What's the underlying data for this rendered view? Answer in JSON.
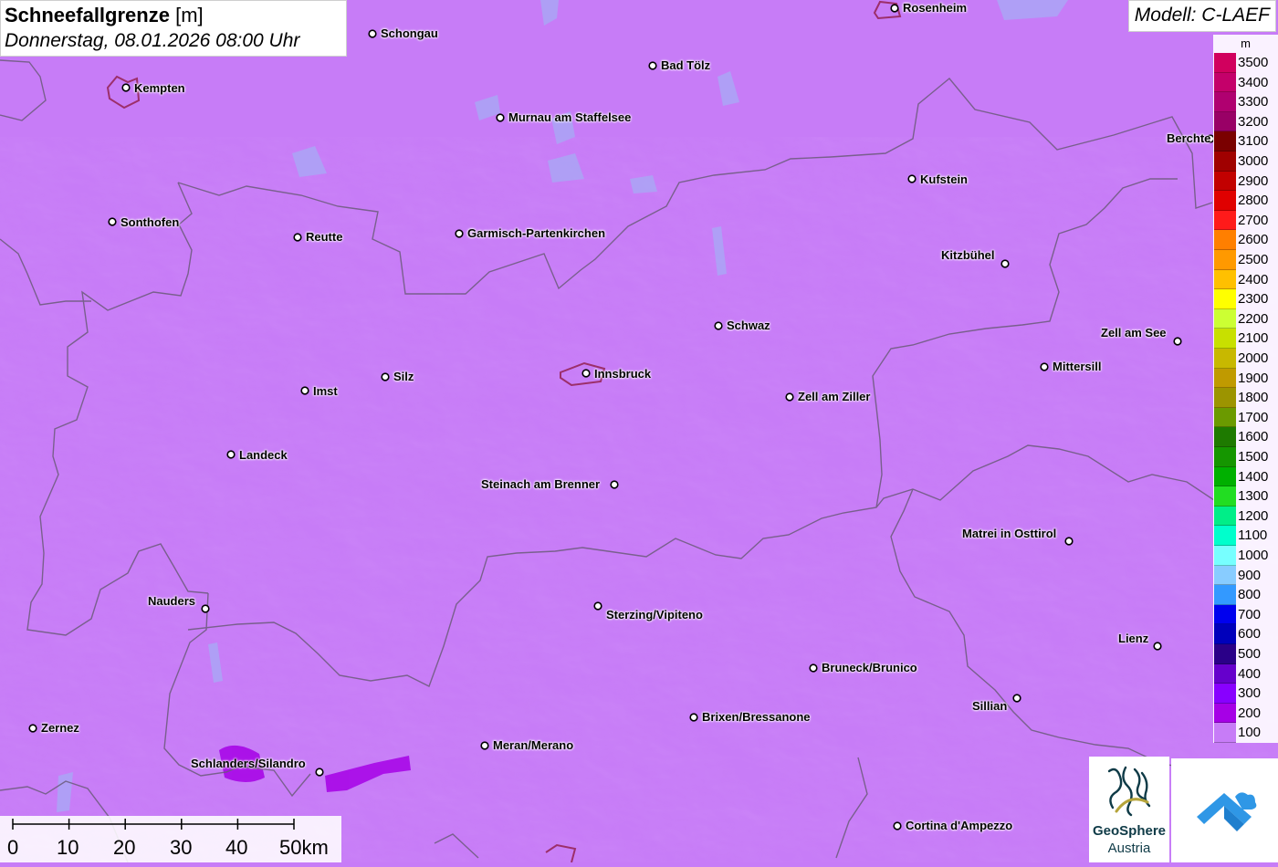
{
  "map": {
    "title": "Schneefallgrenze",
    "unit": "[m]",
    "datetime": "Donnerstag, 08.01.2026 08:00 Uhr",
    "model": "Modell: C-LAEF",
    "background_color": "#c77cf7",
    "cities": [
      {
        "name": "Rosenheim"
      },
      {
        "name": "Schongau"
      },
      {
        "name": "Bad Tölz"
      },
      {
        "name": "Kempten"
      },
      {
        "name": "Murnau am Staffelsee"
      },
      {
        "name": "Berchte"
      },
      {
        "name": "Kufstein"
      },
      {
        "name": "Sonthofen"
      },
      {
        "name": "Reutte"
      },
      {
        "name": "Garmisch-Partenkirchen"
      },
      {
        "name": "Kitzbühel"
      },
      {
        "name": "Schwaz"
      },
      {
        "name": "Zell am See"
      },
      {
        "name": "Mittersill"
      },
      {
        "name": "Innsbruck"
      },
      {
        "name": "Silz"
      },
      {
        "name": "Imst"
      },
      {
        "name": "Zell am Ziller"
      },
      {
        "name": "Landeck"
      },
      {
        "name": "Steinach am Brenner"
      },
      {
        "name": "Matrei in Osttirol"
      },
      {
        "name": "Nauders"
      },
      {
        "name": "Sterzing/Vipiteno"
      },
      {
        "name": "Lienz"
      },
      {
        "name": "Bruneck/Brunico"
      },
      {
        "name": "Sillian"
      },
      {
        "name": "Brixen/Bressanone"
      },
      {
        "name": "Zernez"
      },
      {
        "name": "Meran/Merano"
      },
      {
        "name": "Schlanders/Silandro"
      },
      {
        "name": "Cortina d'Ampezzo"
      }
    ]
  },
  "legend": {
    "unit": "m",
    "entries": [
      {
        "label": "3500",
        "color": "#d1005e"
      },
      {
        "label": "3400",
        "color": "#c4006a"
      },
      {
        "label": "3300",
        "color": "#b00070"
      },
      {
        "label": "3200",
        "color": "#990066"
      },
      {
        "label": "3100",
        "color": "#7a0000"
      },
      {
        "label": "3000",
        "color": "#a00000"
      },
      {
        "label": "2900",
        "color": "#c20000"
      },
      {
        "label": "2800",
        "color": "#e00000"
      },
      {
        "label": "2700",
        "color": "#ff1a1a"
      },
      {
        "label": "2600",
        "color": "#ff7f00"
      },
      {
        "label": "2500",
        "color": "#ff9900"
      },
      {
        "label": "2400",
        "color": "#ffc000"
      },
      {
        "label": "2300",
        "color": "#ffff00"
      },
      {
        "label": "2200",
        "color": "#ccff33"
      },
      {
        "label": "2100",
        "color": "#c8e000"
      },
      {
        "label": "2000",
        "color": "#c8b800"
      },
      {
        "label": "1900",
        "color": "#c09a00"
      },
      {
        "label": "1800",
        "color": "#9c9400"
      },
      {
        "label": "1700",
        "color": "#6b9a00"
      },
      {
        "label": "1600",
        "color": "#1e7a00"
      },
      {
        "label": "1500",
        "color": "#159600"
      },
      {
        "label": "1400",
        "color": "#00b000"
      },
      {
        "label": "1300",
        "color": "#22dd22"
      },
      {
        "label": "1200",
        "color": "#00ee88"
      },
      {
        "label": "1100",
        "color": "#00ffcc"
      },
      {
        "label": "1000",
        "color": "#77ffff"
      },
      {
        "label": "900",
        "color": "#88ccff"
      },
      {
        "label": "800",
        "color": "#3399ff"
      },
      {
        "label": "700",
        "color": "#0000ee"
      },
      {
        "label": "600",
        "color": "#0000bb"
      },
      {
        "label": "500",
        "color": "#2a0088"
      },
      {
        "label": "400",
        "color": "#6600cc"
      },
      {
        "label": "300",
        "color": "#8800ff"
      },
      {
        "label": "200",
        "color": "#a600e6"
      },
      {
        "label": "100",
        "color": "#c77cf7"
      }
    ]
  },
  "scale": {
    "labels": [
      "0",
      "10",
      "20",
      "30",
      "40",
      "50km"
    ]
  },
  "logos": {
    "geosphere_name": "GeoSphere",
    "geosphere_sub": "Austria",
    "app_icon": "cloud-arrow-icon"
  }
}
